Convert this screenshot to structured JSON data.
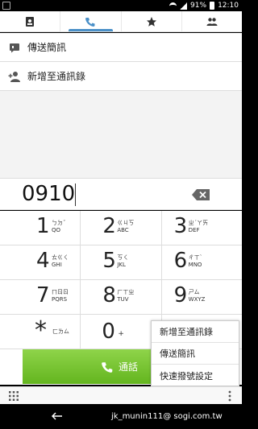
{
  "status_bar": {
    "battery": "91%",
    "time": "12:10"
  },
  "tabs": [
    {
      "name": "contacts",
      "icon": "contacts-icon",
      "active": false
    },
    {
      "name": "phone",
      "icon": "phone-icon",
      "active": true
    },
    {
      "name": "favorites",
      "icon": "star-icon",
      "active": false
    },
    {
      "name": "groups",
      "icon": "groups-icon",
      "active": false
    }
  ],
  "actions": {
    "send_message": "傳送簡訊",
    "add_contact": "新增至通訊錄"
  },
  "dial": {
    "number": "0910"
  },
  "keys": [
    {
      "digit": "1",
      "sub": "ㄅㄉˇ\nQO"
    },
    {
      "digit": "2",
      "sub": "ㄍㄐㄎ\nABC"
    },
    {
      "digit": "3",
      "sub": "ㄓˊㄚㄞ\nDEF"
    },
    {
      "digit": "4",
      "sub": "ㄊㄍㄑ\nGHI"
    },
    {
      "digit": "5",
      "sub": "ㄎㄑ\nJKL"
    },
    {
      "digit": "6",
      "sub": "ㄔㄒˋ\nMNO"
    },
    {
      "digit": "7",
      "sub": "ㄇㄖㄖ\nPQRS"
    },
    {
      "digit": "8",
      "sub": "ㄏㄒㄓ\nTUV"
    },
    {
      "digit": "9",
      "sub": "ㄕㄙ\nWXYZ"
    },
    {
      "digit": "*",
      "sub": "ㄈㄌㄙ"
    },
    {
      "digit": "0",
      "sub": "+"
    }
  ],
  "call_button": {
    "label": "通話"
  },
  "popup_menu": {
    "items": [
      "新增至通訊錄",
      "傳送簡訊",
      "快速撥號設定"
    ]
  },
  "watermark": "jk_munin111@ sogi.com.tw",
  "colors": {
    "accent": "#4a90c8",
    "call_green": "#64b51f"
  }
}
